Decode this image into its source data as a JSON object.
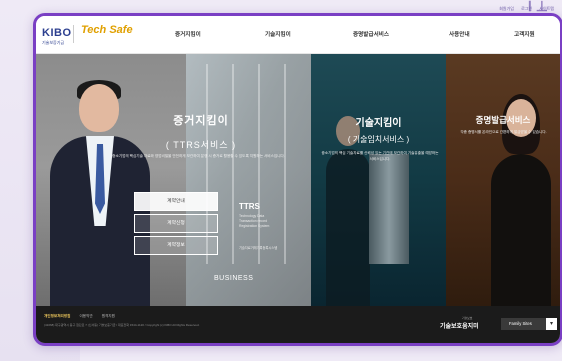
{
  "top_links": [
    "회원가입",
    "로그인",
    "사이트맵"
  ],
  "header": {
    "kibo_logo": "KIBO",
    "kibo_sub": "기술보증기금",
    "brand": "Tech Safe",
    "nav": [
      "증거지킴이",
      "기술지킴이",
      "증명발급서비스",
      "사용안내",
      "고객지원"
    ]
  },
  "panel1": {
    "title": "증거지킴이",
    "subtitle": "( TTRS서비스 )",
    "desc": "중소기업의 핵심기술 자료와 영업비밀을 안전하게 보관하여 분쟁 시 증거로 활용할 수 있도록 지원하는 서비스입니다.",
    "buttons": [
      "계약안내",
      "계약신청",
      "계약정보"
    ],
    "active_button_index": 0,
    "ttrs_title": "TTRS",
    "ttrs_sub": "Technology Data Transaction record Registration System",
    "ttrs_kor": "기술자료거래기록등록시스템",
    "business": "BUSINESS"
  },
  "panel2": {
    "title": "기술지킴이",
    "subtitle": "( 기술임치서비스 )",
    "desc": "중소기업의 핵심 기술자료를 신뢰성 있는 기관에 보관하여 기술유출을 예방하는 서비스입니다."
  },
  "panel3": {
    "title": "증명발급서비스",
    "desc": "각종 증명서를 온라인으로 간편하게 발급받을 수 있습니다."
  },
  "footer": {
    "links": [
      "개인정보처리방침",
      "이용약관",
      "원격지원"
    ],
    "address": "(41068) 대구광역시 동구 첨단로 7 (신서동) 기술보증기금 / 대표전화 1544-1120 / Copyright (c) KIBO All Rights Reserved.",
    "logo": "기술보호움지미",
    "logo_sub": "기술보호",
    "family_label": "Family Sites",
    "family_caret": "▾"
  }
}
